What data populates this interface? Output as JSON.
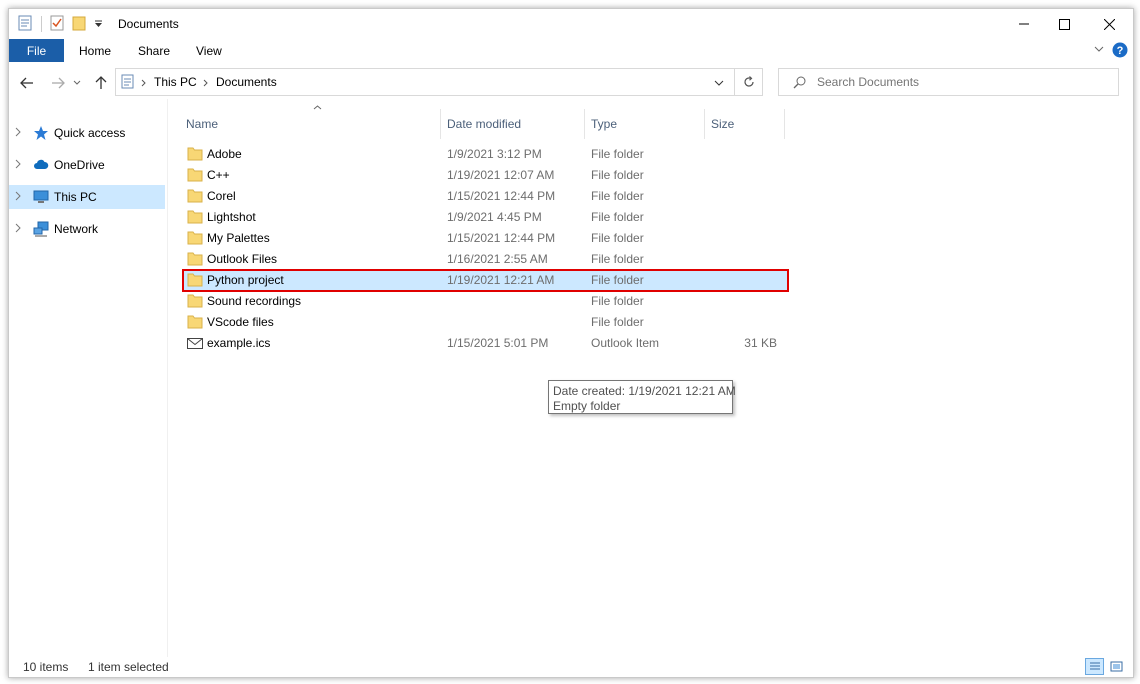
{
  "window": {
    "title": "Documents",
    "controls": {
      "minimize": "minimize-icon",
      "maximize": "maximize-icon",
      "close": "close-icon"
    }
  },
  "ribbon": {
    "tabs": [
      "File",
      "Home",
      "Share",
      "View"
    ]
  },
  "address": {
    "path": [
      "This PC",
      "Documents"
    ],
    "search_placeholder": "Search Documents"
  },
  "nav_pane": {
    "items": [
      {
        "label": "Quick access",
        "icon": "star-icon"
      },
      {
        "label": "OneDrive",
        "icon": "cloud-icon"
      },
      {
        "label": "This PC",
        "icon": "computer-icon",
        "selected": true
      },
      {
        "label": "Network",
        "icon": "network-icon"
      }
    ]
  },
  "columns": {
    "name": "Name",
    "date": "Date modified",
    "type": "Type",
    "size": "Size"
  },
  "files": [
    {
      "name": "Adobe",
      "date": "1/9/2021 3:12 PM",
      "type": "File folder",
      "size": "",
      "icon": "folder-icon"
    },
    {
      "name": "C++",
      "date": "1/19/2021 12:07 AM",
      "type": "File folder",
      "size": "",
      "icon": "folder-icon"
    },
    {
      "name": "Corel",
      "date": "1/15/2021 12:44 PM",
      "type": "File folder",
      "size": "",
      "icon": "folder-icon"
    },
    {
      "name": "Lightshot",
      "date": "1/9/2021 4:45 PM",
      "type": "File folder",
      "size": "",
      "icon": "folder-icon"
    },
    {
      "name": "My Palettes",
      "date": "1/15/2021 12:44 PM",
      "type": "File folder",
      "size": "",
      "icon": "folder-icon"
    },
    {
      "name": "Outlook Files",
      "date": "1/16/2021 2:55 AM",
      "type": "File folder",
      "size": "",
      "icon": "folder-icon"
    },
    {
      "name": "Python project",
      "date": "1/19/2021 12:21 AM",
      "type": "File folder",
      "size": "",
      "icon": "folder-icon",
      "selected": true
    },
    {
      "name": "Sound recordings",
      "date": "",
      "type": "File folder",
      "size": "",
      "icon": "folder-icon"
    },
    {
      "name": "VScode files",
      "date": "",
      "type": "File folder",
      "size": "",
      "icon": "folder-icon"
    },
    {
      "name": "example.ics",
      "date": "1/15/2021 5:01 PM",
      "type": "Outlook Item",
      "size": "31 KB",
      "icon": "mail-icon"
    }
  ],
  "tooltip": {
    "line1": "Date created: 1/19/2021 12:21 AM",
    "line2": "Empty folder"
  },
  "status": {
    "count": "10 items",
    "selection": "1 item selected"
  },
  "colors": {
    "file_tab": "#1b5ea8",
    "selection": "#cce8ff",
    "highlight_border": "#e00000",
    "folder": "#f8d775"
  }
}
